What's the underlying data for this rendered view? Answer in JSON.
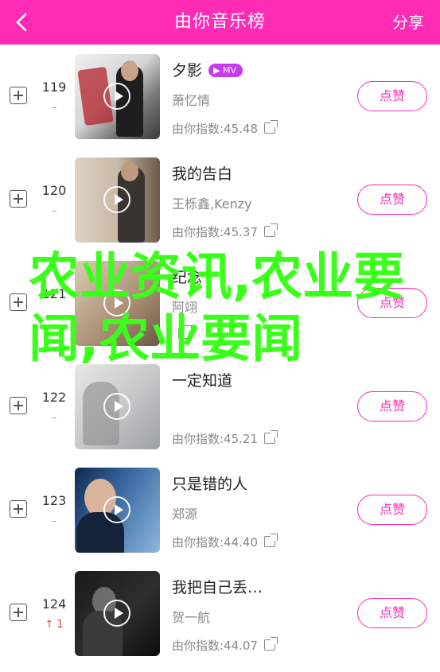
{
  "header": {
    "title": "由你音乐榜",
    "share": "分享",
    "back_icon": "chevron-left-icon"
  },
  "colors": {
    "accent": "#ff2bb5",
    "mv_badge": "#c83af0",
    "overlay_text": "#3aff1a",
    "trend_up": "#e8413b"
  },
  "songs": [
    {
      "rank": "119",
      "trend": "–",
      "title": "夕影",
      "mv": "MV",
      "artist": "萧忆情",
      "index": "由你指数:45.48",
      "like": "点赞"
    },
    {
      "rank": "120",
      "trend": "–",
      "title": "我的告白",
      "artist": "王栎鑫,Kenzy",
      "index": "由你指数:45.37",
      "like": "点赞"
    },
    {
      "rank": "121",
      "trend": "",
      "title": "纪念",
      "artist": "阿翊",
      "index": "",
      "like": "点赞"
    },
    {
      "rank": "122",
      "trend": "–",
      "title": "一定知道",
      "artist": "",
      "index": "由你指数:45.21",
      "like": "点赞"
    },
    {
      "rank": "123",
      "trend": "–",
      "title": "只是错的人",
      "artist": "郑源",
      "index": "由你指数:44.40",
      "like": "点赞"
    },
    {
      "rank": "124",
      "trend": "↑ 1",
      "title": "我把自己丢…",
      "artist": "贺一航",
      "index": "由你指数:44.07",
      "like": "点赞"
    }
  ],
  "overlay": {
    "text": "农业资讯,农业要闻,农业要闻"
  }
}
